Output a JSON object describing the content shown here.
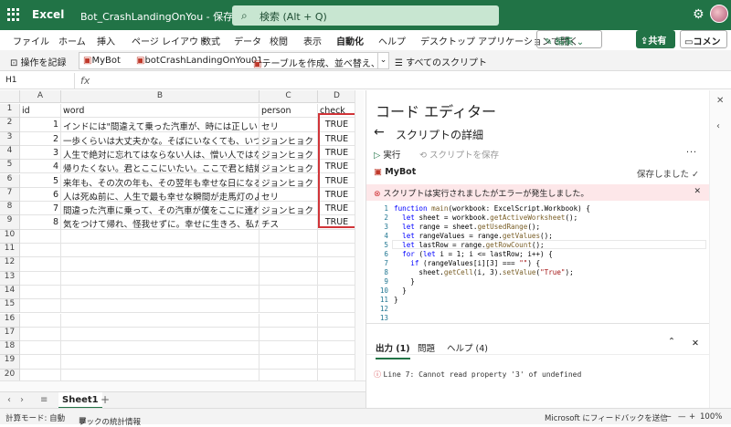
{
  "titlebar": {
    "app": "Excel",
    "doc": "Bot_CrashLandingOnYou - 保存済み ⌄",
    "search_placeholder": "検索 (Alt + Q)"
  },
  "menu": {
    "items": [
      "ファイル",
      "ホーム",
      "挿入",
      "ページ レイアウト",
      "数式",
      "データ",
      "校閲",
      "表示",
      "自動化",
      "ヘルプ",
      "デスクトップ アプリケーションで開く"
    ],
    "active": "自動化",
    "edit": "編集 ⌄",
    "share": "共有",
    "comment": "コメント"
  },
  "ribbon": {
    "record": "操作を記録",
    "scripts": [
      "MyBot",
      "botCrashLandingOnYou01",
      "テーブルを作成、並べ替え、および…"
    ],
    "all_scripts": "すべてのスクリプト"
  },
  "formula": {
    "namebox": "H1",
    "fx": "fx"
  },
  "sheet": {
    "columns": [
      "A",
      "B",
      "C",
      "D"
    ],
    "rows": [
      {
        "n": "1",
        "a": "id",
        "b": "word",
        "c": "person",
        "d": "check"
      },
      {
        "n": "2",
        "a": "1",
        "b": "インドには\"間違えて乗った汽車が、時には正しい目",
        "c": "セリ",
        "d": "TRUE"
      },
      {
        "n": "3",
        "a": "2",
        "b": "一歩くらいは大丈夫かな。そばにいなくても、いつ",
        "c": "ジョンヒョク",
        "d": "TRUE"
      },
      {
        "n": "4",
        "a": "3",
        "b": "人生で絶対に忘れてはならない人は、憎い人ではな",
        "c": "ジョンヒョク",
        "d": "TRUE"
      },
      {
        "n": "5",
        "a": "4",
        "b": "帰りたくない。君とここにいたい。ここで君と結婚",
        "c": "ジョンヒョク",
        "d": "TRUE"
      },
      {
        "n": "6",
        "a": "5",
        "b": "来年も、その次の年も、その翌年も幸せな日になる",
        "c": "ジョンヒョク",
        "d": "TRUE"
      },
      {
        "n": "7",
        "a": "6",
        "b": "人は死ぬ前に、人生で最も幸せな瞬間が走馬灯のよ",
        "c": "セリ",
        "d": "TRUE"
      },
      {
        "n": "8",
        "a": "7",
        "b": "間違った汽車に乗って、その汽車が僕をここに連れ",
        "c": "ジョンヒョク",
        "d": "TRUE"
      },
      {
        "n": "9",
        "a": "8",
        "b": "気をつけて帰れ、怪我せずに。幸せに生きろ、私た",
        "c": "チス",
        "d": "TRUE"
      },
      {
        "n": "10",
        "a": "",
        "b": "",
        "c": "",
        "d": ""
      },
      {
        "n": "11",
        "a": "",
        "b": "",
        "c": "",
        "d": ""
      },
      {
        "n": "12",
        "a": "",
        "b": "",
        "c": "",
        "d": ""
      },
      {
        "n": "13",
        "a": "",
        "b": "",
        "c": "",
        "d": ""
      },
      {
        "n": "14",
        "a": "",
        "b": "",
        "c": "",
        "d": ""
      },
      {
        "n": "15",
        "a": "",
        "b": "",
        "c": "",
        "d": ""
      },
      {
        "n": "16",
        "a": "",
        "b": "",
        "c": "",
        "d": ""
      },
      {
        "n": "17",
        "a": "",
        "b": "",
        "c": "",
        "d": ""
      },
      {
        "n": "18",
        "a": "",
        "b": "",
        "c": "",
        "d": ""
      },
      {
        "n": "19",
        "a": "",
        "b": "",
        "c": "",
        "d": ""
      },
      {
        "n": "20",
        "a": "",
        "b": "",
        "c": "",
        "d": ""
      }
    ],
    "tab": "Sheet1"
  },
  "status": {
    "mode": "計算モード: 自動",
    "stats": "ブックの統計情報",
    "feedback": "Microsoft にフィードバックを送信",
    "zoom": "100%"
  },
  "editor": {
    "title": "コード エディター",
    "subtitle": "スクリプトの詳細",
    "run": "実行",
    "save": "スクリプトを保存",
    "script_name": "MyBot",
    "saved": "保存しました ✓",
    "error_banner": "スクリプトは実行されましたがエラーが発生しました。",
    "tabs": [
      "出力 (1)",
      "問題",
      "ヘルプ (4)"
    ],
    "output": "Line 7: Cannot read property '3' of undefined"
  }
}
